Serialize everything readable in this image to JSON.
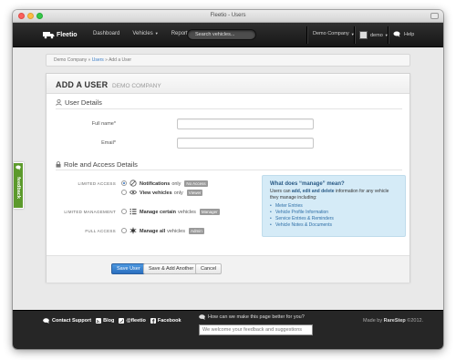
{
  "window": {
    "title": "Fleetio - Users"
  },
  "nav": {
    "logo_text": "Fleetio",
    "links": [
      "Dashboard",
      "Vehicles",
      "Reports"
    ],
    "search_placeholder": "Search vehicles...",
    "company": "Demo Company",
    "user": "demo",
    "help": "Help"
  },
  "breadcrumb": {
    "root": "Demo Company",
    "sep1": "»",
    "users": "Users",
    "sep2": "»",
    "current": "Add a User"
  },
  "card": {
    "title": "ADD A USER",
    "subtitle": "DEMO COMPANY",
    "user_details_heading": "User Details",
    "full_name_label": "Full name*",
    "email_label": "Email*",
    "full_name_value": "",
    "email_value": "",
    "role_heading": "Role and Access Details",
    "roles": [
      {
        "label": "LIMITED ACCESS",
        "options": [
          {
            "bold": "Notifications",
            "rest": "only",
            "tag": "No Access",
            "selected": true
          },
          {
            "bold": "View vehicles",
            "rest": "only",
            "tag": "Viewer",
            "selected": false
          }
        ]
      },
      {
        "label": "LIMITED MANAGEMENT",
        "options": [
          {
            "bold": "Manage certain",
            "rest": "vehicles",
            "tag": "Manager",
            "selected": false
          }
        ]
      },
      {
        "label": "FULL ACCESS",
        "options": [
          {
            "bold": "Manage all",
            "rest": "vehicles",
            "tag": "Admin",
            "selected": false
          }
        ]
      }
    ],
    "info": {
      "title": "What does “manage” mean?",
      "text_a": "Users can ",
      "text_b": "add, edit and delete",
      "text_c": " information for any vehicle they manage including:",
      "items": [
        "Meter Entries",
        "Vehicle Profile Information",
        "Service Entries & Reminders",
        "Vehicle Notes & Documents"
      ]
    },
    "buttons": {
      "save": "Save User",
      "save_add": "Save & Add Another",
      "cancel": "Cancel"
    }
  },
  "feedback_tab": "feedback",
  "footer": {
    "links": [
      "Contact Support",
      "Blog",
      "@fleetio",
      "Facebook"
    ],
    "question": "How can we make this page better for you?",
    "input_placeholder": "We welcome your feedback and suggestions",
    "credit_prefix": "Made by ",
    "credit_name": "RareStep",
    "credit_suffix": " ©2012."
  },
  "colors": {
    "primary": "#2f74c4",
    "nav_bg": "#1f1f1f",
    "info_bg": "#d5ebf7",
    "feedback_green": "#5c9a2c"
  }
}
